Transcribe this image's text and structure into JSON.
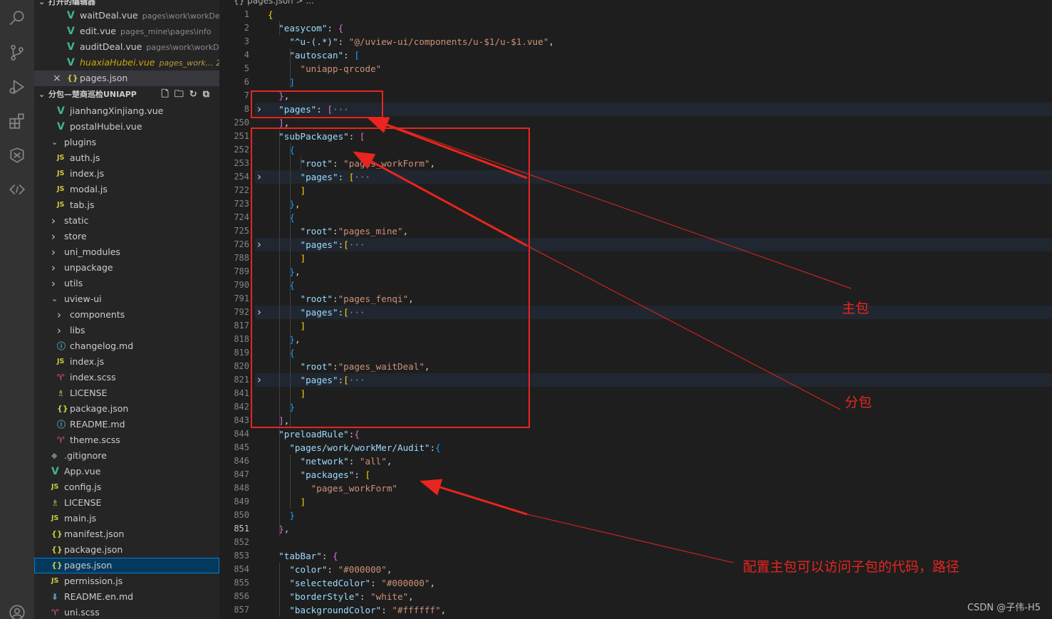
{
  "activity_bar": {
    "icons": [
      "search-icon",
      "source-control-icon",
      "run-debug-icon",
      "extensions-icon",
      "hbuilder-icon",
      "remote-icon",
      "account-icon"
    ]
  },
  "sidebar": {
    "open_editors_header": "打开的编辑器",
    "open_editors": [
      {
        "name": "waitDeal.vue",
        "desc": "pages\\work\\workDeal",
        "icon": "vue-icon"
      },
      {
        "name": "edit.vue",
        "desc": "pages_mine\\pages\\info",
        "icon": "vue-icon"
      },
      {
        "name": "auditDeal.vue",
        "desc": "pages\\work\\workD...",
        "icon": "vue-icon"
      },
      {
        "name": "huaxiaHubei.vue",
        "desc": "pages_work...",
        "badge": "2",
        "icon": "vue-icon"
      },
      {
        "name": "pages.json",
        "close": "×",
        "icon": "json-icon"
      }
    ],
    "project_header": "分包—楚商巡检UNIAPP",
    "tree": [
      {
        "name": "jianhangXinjiang.vue",
        "icon": "vue",
        "indent": 2
      },
      {
        "name": "postalHubei.vue",
        "icon": "vue",
        "indent": 2
      },
      {
        "name": "plugins",
        "folder": "open",
        "indent": 1
      },
      {
        "name": "auth.js",
        "icon": "js",
        "indent": 2
      },
      {
        "name": "index.js",
        "icon": "js",
        "indent": 2
      },
      {
        "name": "modal.js",
        "icon": "js",
        "indent": 2
      },
      {
        "name": "tab.js",
        "icon": "js",
        "indent": 2
      },
      {
        "name": "static",
        "folder": "closed",
        "indent": 1
      },
      {
        "name": "store",
        "folder": "closed",
        "indent": 1
      },
      {
        "name": "uni_modules",
        "folder": "closed",
        "indent": 1
      },
      {
        "name": "unpackage",
        "folder": "closed",
        "indent": 1
      },
      {
        "name": "utils",
        "folder": "closed",
        "indent": 1
      },
      {
        "name": "uview-ui",
        "folder": "open",
        "indent": 1
      },
      {
        "name": "components",
        "folder": "closed",
        "indent": 2
      },
      {
        "name": "libs",
        "folder": "closed",
        "indent": 2
      },
      {
        "name": "changelog.md",
        "icon": "md",
        "indent": 2
      },
      {
        "name": "index.js",
        "icon": "js",
        "indent": 2
      },
      {
        "name": "index.scss",
        "icon": "scss",
        "indent": 2
      },
      {
        "name": "LICENSE",
        "icon": "lic",
        "indent": 2
      },
      {
        "name": "package.json",
        "icon": "json",
        "indent": 2
      },
      {
        "name": "README.md",
        "icon": "md",
        "indent": 2
      },
      {
        "name": "theme.scss",
        "icon": "scss",
        "indent": 2
      },
      {
        "name": ".gitignore",
        "icon": "git",
        "indent": 1
      },
      {
        "name": "App.vue",
        "icon": "vue",
        "indent": 1
      },
      {
        "name": "config.js",
        "icon": "js",
        "indent": 1
      },
      {
        "name": "LICENSE",
        "icon": "lic",
        "indent": 1
      },
      {
        "name": "main.js",
        "icon": "js",
        "indent": 1
      },
      {
        "name": "manifest.json",
        "icon": "json",
        "indent": 1
      },
      {
        "name": "package.json",
        "icon": "json",
        "indent": 1
      },
      {
        "name": "pages.json",
        "icon": "json",
        "indent": 1,
        "selected": true
      },
      {
        "name": "permission.js",
        "icon": "js",
        "indent": 1
      },
      {
        "name": "README.en.md",
        "icon": "dl",
        "indent": 1
      },
      {
        "name": "uni.scss",
        "icon": "scss",
        "indent": 1
      }
    ]
  },
  "editor": {
    "breadcrumb": "{} pages.json > ...",
    "lines": [
      {
        "n": "1",
        "html": "<span class='b1'>{</span>"
      },
      {
        "n": "2",
        "html": "  <span class='k'>\"easycom\"</span>: <span class='b2'>{</span>"
      },
      {
        "n": "3",
        "html": "    <span class='k'>\"^u-(.*)\"</span>: <span class='s'>\"@/uview-ui/components/u-$1/u-$1.vue\"</span>,"
      },
      {
        "n": "4",
        "html": "    <span class='k'>\"autoscan\"</span>: <span class='b3'>[</span>"
      },
      {
        "n": "5",
        "html": "      <span class='s'>\"uniapp-qrcode\"</span>"
      },
      {
        "n": "6",
        "html": "    <span class='b3'>]</span>"
      },
      {
        "n": "7",
        "html": "  <span class='b2'>}</span>,"
      },
      {
        "n": "8",
        "html": "  <span class='k'>\"pages\"</span>: <span class='b2'>[</span><span class='dots'>···</span>",
        "fold": true
      },
      {
        "n": "250",
        "html": "  <span class='b2'>]</span>,"
      },
      {
        "n": "251",
        "html": "  <span class='k'>\"subPackages\"</span>: <span class='b2'>[</span>"
      },
      {
        "n": "252",
        "html": "    <span class='b3'>{</span>"
      },
      {
        "n": "253",
        "html": "      <span class='k'>\"root\"</span>: <span class='s'>\"pages_workForm\"</span>,"
      },
      {
        "n": "254",
        "html": "      <span class='k'>\"pages\"</span>: <span class='b1'>[</span><span class='dots'>···</span>",
        "fold": true
      },
      {
        "n": "722",
        "html": "      <span class='b1'>]</span>"
      },
      {
        "n": "723",
        "html": "    <span class='b3'>}</span>,"
      },
      {
        "n": "724",
        "html": "    <span class='b3'>{</span>"
      },
      {
        "n": "725",
        "html": "      <span class='k'>\"root\"</span>:<span class='s'>\"pages_mine\"</span>,"
      },
      {
        "n": "726",
        "html": "      <span class='k'>\"pages\"</span>:<span class='b1'>[</span><span class='dots'>···</span>",
        "fold": true
      },
      {
        "n": "788",
        "html": "      <span class='b1'>]</span>"
      },
      {
        "n": "789",
        "html": "    <span class='b3'>}</span>,"
      },
      {
        "n": "790",
        "html": "    <span class='b3'>{</span>"
      },
      {
        "n": "791",
        "html": "      <span class='k'>\"root\"</span>:<span class='s'>\"pages_fenqi\"</span>,"
      },
      {
        "n": "792",
        "html": "      <span class='k'>\"pages\"</span>:<span class='b1'>[</span><span class='dots'>···</span>",
        "fold": true
      },
      {
        "n": "817",
        "html": "      <span class='b1'>]</span>"
      },
      {
        "n": "818",
        "html": "    <span class='b3'>}</span>,"
      },
      {
        "n": "819",
        "html": "    <span class='b3'>{</span>"
      },
      {
        "n": "820",
        "html": "      <span class='k'>\"root\"</span>:<span class='s'>\"pages_waitDeal\"</span>,"
      },
      {
        "n": "821",
        "html": "      <span class='k'>\"pages\"</span>:<span class='b1'>[</span><span class='dots'>···</span>",
        "fold": true
      },
      {
        "n": "841",
        "html": "      <span class='b1'>]</span>"
      },
      {
        "n": "842",
        "html": "    <span class='b3'>}</span>"
      },
      {
        "n": "843",
        "html": "  <span class='b2'>]</span>,"
      },
      {
        "n": "844",
        "html": "  <span class='k'>\"preloadRule\"</span>:<span class='b2'>{</span>"
      },
      {
        "n": "845",
        "html": "    <span class='k'>\"pages/work/workMer/Audit\"</span>:<span class='b3'>{</span>"
      },
      {
        "n": "846",
        "html": "      <span class='k'>\"network\"</span>: <span class='s'>\"all\"</span>,"
      },
      {
        "n": "847",
        "html": "      <span class='k'>\"packages\"</span>: <span class='b1'>[</span>"
      },
      {
        "n": "848",
        "html": "        <span class='s'>\"pages_workForm\"</span>"
      },
      {
        "n": "849",
        "html": "      <span class='b1'>]</span>"
      },
      {
        "n": "850",
        "html": "    <span class='b3'>}</span>"
      },
      {
        "n": "851",
        "html": "  <span class='b2'>}</span>,",
        "current": true
      },
      {
        "n": "852",
        "html": ""
      },
      {
        "n": "853",
        "html": "  <span class='k'>\"tabBar\"</span>: <span class='b2'>{</span>"
      },
      {
        "n": "854",
        "html": "    <span class='k'>\"color\"</span>: <span class='s'>\"#000000\"</span>,"
      },
      {
        "n": "855",
        "html": "    <span class='k'>\"selectedColor\"</span>: <span class='s'>\"#000000\"</span>,"
      },
      {
        "n": "856",
        "html": "    <span class='k'>\"borderStyle\"</span>: <span class='s'>\"white\"</span>,"
      },
      {
        "n": "857",
        "html": "    <span class='k'>\"backgroundColor\"</span>: <span class='s'>\"#ffffff\"</span>,"
      }
    ]
  },
  "annotations": {
    "main_package": "主包",
    "sub_package": "分包",
    "preload_note": "配置主包可以访问子包的代码，路径",
    "color": "#e8251e"
  },
  "watermark": "CSDN @子伟-H5"
}
